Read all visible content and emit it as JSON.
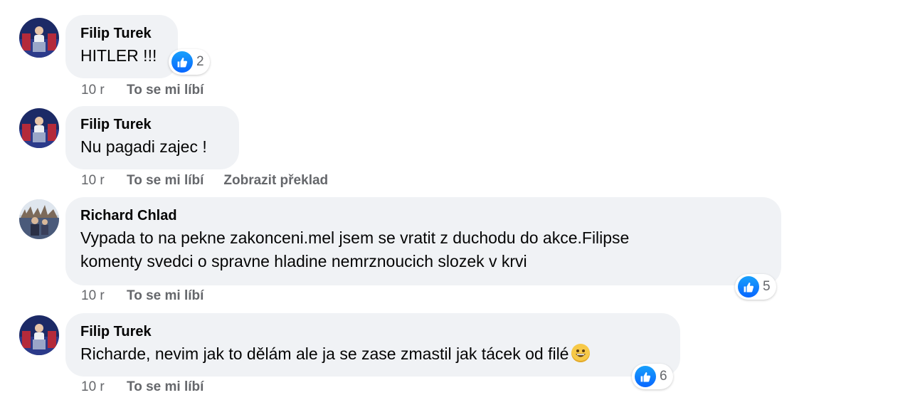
{
  "like_color": "#0866ff",
  "comments": [
    {
      "author": "Filip Turek",
      "text": "HITLER !!!",
      "reactions": "2",
      "time": "10 r",
      "like_label": "To se mi líbí",
      "avatar_icon": "profile-photo-stage"
    },
    {
      "author": "Filip Turek",
      "text": "Nu pagadi zajec !",
      "time": "10 r",
      "like_label": "To se mi líbí",
      "translate_label": "Zobrazit překlad",
      "avatar_icon": "profile-photo-stage"
    },
    {
      "author": "Richard Chlad",
      "text_line1": "Vypada to na pekne zakonceni.mel jsem se vratit z duchodu do akce.Filipse",
      "text_line2": "komenty svedci o spravne hladine nemrznoucich slozek v krvi",
      "reactions": "5",
      "time": "10 r",
      "like_label": "To se mi líbí",
      "avatar_icon": "profile-photo-city"
    },
    {
      "author": "Filip Turek",
      "text": "Richarde, nevim jak to dělám ale ja se zase zmastil jak tácek od filé",
      "emoji_icon": "grinning-face-emoji",
      "reactions": "6",
      "time": "10 r",
      "like_label": "To se mi líbí",
      "avatar_icon": "profile-photo-stage"
    }
  ]
}
